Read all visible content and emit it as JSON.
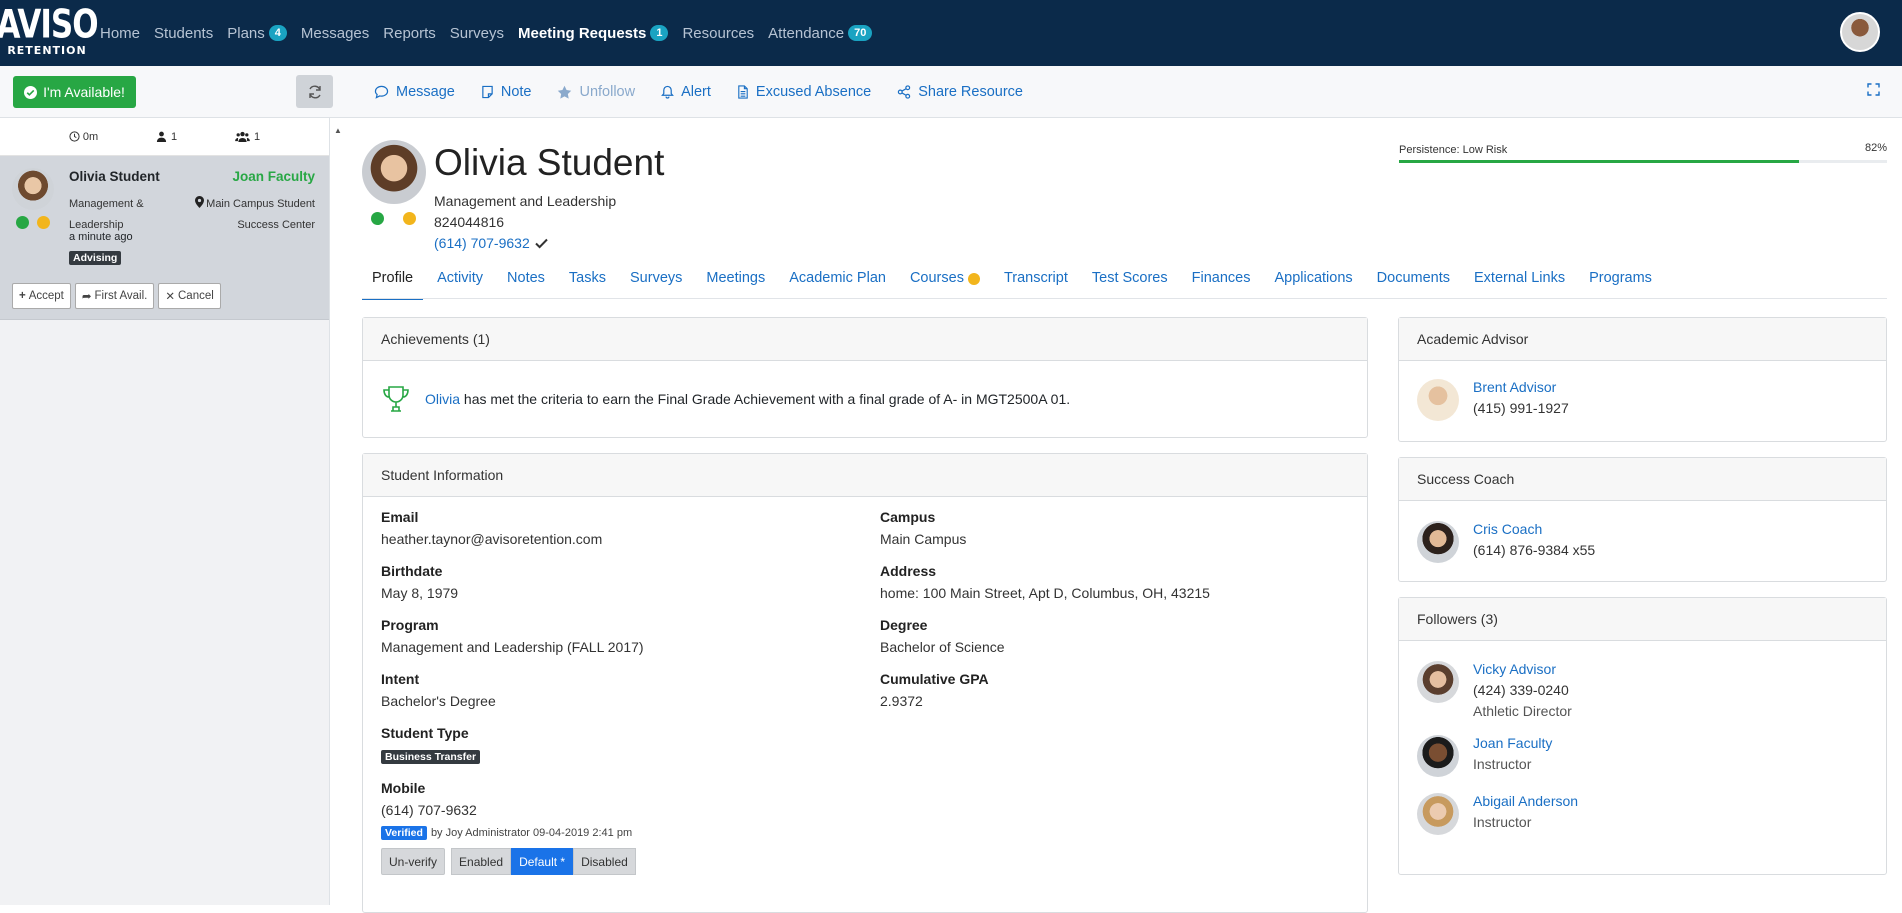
{
  "logo": {
    "line1": "AVISO",
    "line2": "RETENTION"
  },
  "nav": [
    {
      "label": "Home"
    },
    {
      "label": "Students"
    },
    {
      "label": "Plans",
      "badge": "4"
    },
    {
      "label": "Messages"
    },
    {
      "label": "Reports"
    },
    {
      "label": "Surveys"
    },
    {
      "label": "Meeting Requests",
      "badge": "1",
      "active": true
    },
    {
      "label": "Resources"
    },
    {
      "label": "Attendance",
      "badge": "70"
    }
  ],
  "toolbar": {
    "available_label": "I'm Available!",
    "actions": [
      {
        "label": "Message",
        "icon": "chat-bubble-icon"
      },
      {
        "label": "Note",
        "icon": "note-icon"
      },
      {
        "label": "Unfollow",
        "icon": "star-icon"
      },
      {
        "label": "Alert",
        "icon": "bell-icon"
      },
      {
        "label": "Excused Absence",
        "icon": "document-icon"
      },
      {
        "label": "Share Resource",
        "icon": "share-icon"
      }
    ]
  },
  "queue": {
    "stats": {
      "time": "0m",
      "single": "1",
      "group": "1"
    },
    "item": {
      "name": "Olivia Student",
      "faculty": "Joan Faculty",
      "program": "Management & Leadership",
      "location": "Main Campus Student Success Center",
      "time": "a minute ago",
      "tag": "Advising",
      "buttons": {
        "accept": "Accept",
        "first": "First Avail.",
        "cancel": "Cancel"
      }
    }
  },
  "student": {
    "name": "Olivia Student",
    "program": "Management and Leadership",
    "id": "824044816",
    "phone": "(614) 707-9632",
    "persistence_label": "Persistence: Low Risk",
    "persistence_pct_text": "82%",
    "persistence_value": 82
  },
  "tabs": [
    "Profile",
    "Activity",
    "Notes",
    "Tasks",
    "Surveys",
    "Meetings",
    "Academic Plan",
    "Courses",
    "Transcript",
    "Test Scores",
    "Finances",
    "Applications",
    "Documents",
    "External Links",
    "Programs"
  ],
  "achievements": {
    "title": "Achievements (1)",
    "link": "Olivia",
    "text": "has met the criteria to earn the Final Grade Achievement with a final grade of A- in MGT2500A 01."
  },
  "info": {
    "title": "Student Information",
    "email_label": "Email",
    "email": "heather.taynor@avisoretention.com",
    "birth_label": "Birthdate",
    "birth": "May 8, 1979",
    "program_label": "Program",
    "program": "Management and Leadership (FALL 2017)",
    "intent_label": "Intent",
    "intent": "Bachelor's Degree",
    "type_label": "Student Type",
    "type": "Business Transfer",
    "mobile_label": "Mobile",
    "mobile": "(614) 707-9632",
    "verified": "Verified",
    "verified_by": "by Joy Administrator 09-04-2019 2:41 pm",
    "unverify": "Un-verify",
    "enabled": "Enabled",
    "default": "Default *",
    "disabled": "Disabled",
    "campus_label": "Campus",
    "campus": "Main Campus",
    "address_label": "Address",
    "address": "home: 100 Main Street, Apt D, Columbus, OH, 43215",
    "degree_label": "Degree",
    "degree": "Bachelor of Science",
    "gpa_label": "Cumulative GPA",
    "gpa": "2.9372"
  },
  "advisor": {
    "title": "Academic Advisor",
    "name": "Brent Advisor",
    "phone": "(415) 991-1927"
  },
  "coach": {
    "title": "Success Coach",
    "name": "Cris Coach",
    "phone": "(614) 876-9384 x55"
  },
  "followers": {
    "title": "Followers (3)",
    "list": [
      {
        "name": "Vicky Advisor",
        "phone": "(424) 339-0240",
        "role": "Athletic Director"
      },
      {
        "name": "Joan Faculty",
        "role": "Instructor"
      },
      {
        "name": "Abigail Anderson",
        "role": "Instructor"
      }
    ]
  },
  "colors": {
    "nav_bg": "#0b2a4a",
    "link": "#1a6fc4",
    "success": "#27a744",
    "warning": "#f2b51c"
  }
}
